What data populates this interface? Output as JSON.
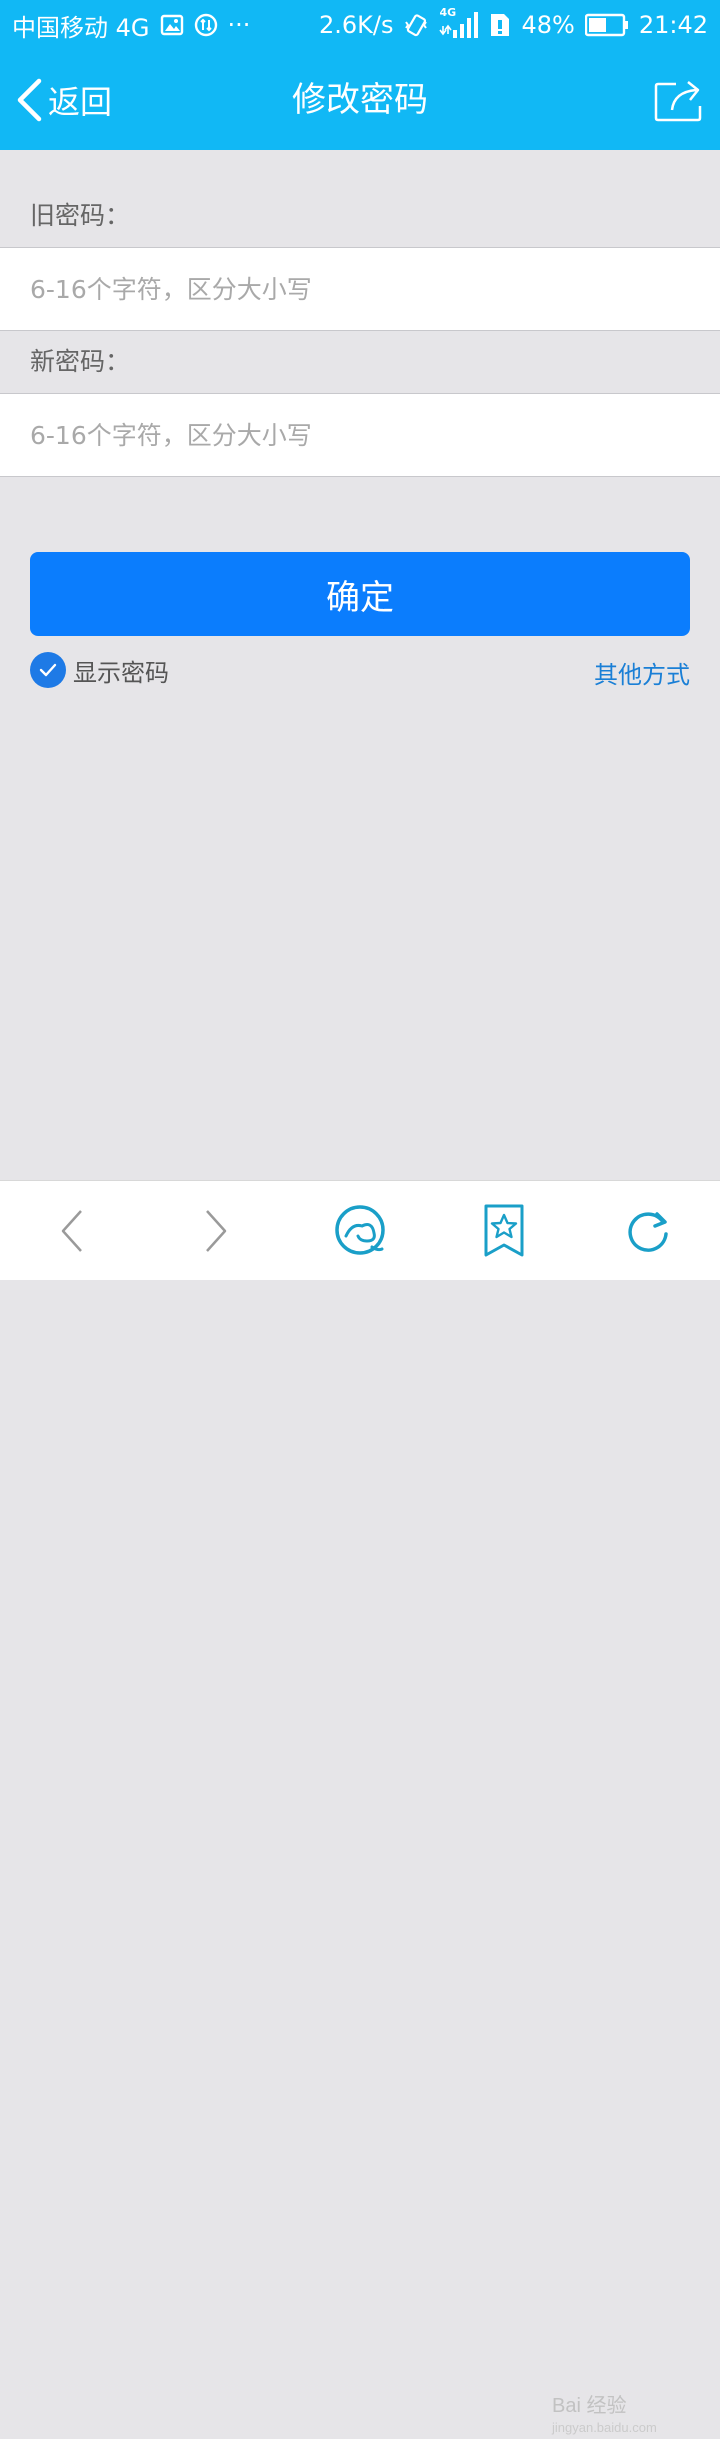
{
  "status_bar": {
    "carrier": "中国移动 4G",
    "dots": "···",
    "speed": "2.6K/s",
    "network_badge": "4G",
    "battery": "48%",
    "time": "21:42",
    "icons": [
      "image-icon",
      "sync-icon",
      "vibrate-icon",
      "signal-icon",
      "sim-alert-icon",
      "battery-icon"
    ]
  },
  "nav": {
    "back_label": "返回",
    "title": "修改密码",
    "share_icon": "share-icon"
  },
  "form": {
    "old_password_label": "旧密码：",
    "old_password_placeholder": "6-16个字符，区分大小写",
    "old_password_value": "",
    "new_password_label": "新密码：",
    "new_password_placeholder": "6-16个字符，区分大小写",
    "new_password_value": "",
    "confirm_label": "确定",
    "show_password_label": "显示密码",
    "show_password_checked": true,
    "other_methods_label": "其他方式"
  },
  "toolbar": {
    "items": [
      "back-icon",
      "forward-icon",
      "home-icon",
      "bookmark-star-icon",
      "refresh-icon"
    ]
  },
  "watermark": {
    "brand": "Bai 经验",
    "url": "jingyan.baidu.com"
  },
  "colors": {
    "header": "#11b8f5",
    "background": "#e6e5e8",
    "primary_button": "#0b7dfd",
    "link": "#1a7fd6",
    "toolbar_icon": "#1a9fc8"
  }
}
